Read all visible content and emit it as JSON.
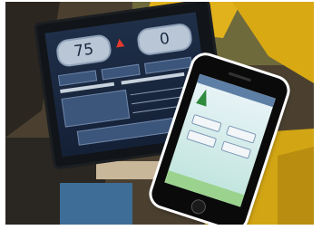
{
  "photo": {
    "description_icons": [
      "warning-icon",
      "tree-icon"
    ],
    "monitor": {
      "gauge_left_value": "75",
      "gauge_right_value": "0"
    },
    "phone": {
      "buttons": [
        "",
        "",
        "",
        ""
      ]
    }
  },
  "colors": {
    "cab_yellow": "#e5b21c",
    "monitor_screen": "#1f2f48",
    "gauge_face": "#b9c6d6",
    "warning_red": "#e23b2e",
    "phone_screen": "#eaf4f8",
    "app_green": "#2e8b3c"
  }
}
